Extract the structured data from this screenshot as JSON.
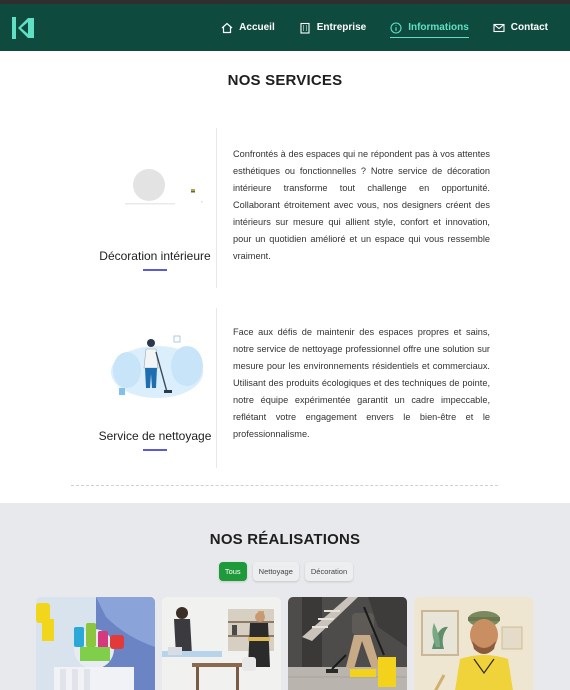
{
  "colors": {
    "navbar": "#0f4a3e",
    "active": "#5fe0c4",
    "accent_underline": "#5b5bd6",
    "filter_active": "#1e9a3a"
  },
  "nav": {
    "items": [
      {
        "label": "Accueil",
        "icon": "home-icon"
      },
      {
        "label": "Entreprise",
        "icon": "building-icon"
      },
      {
        "label": "Informations",
        "icon": "info-icon",
        "active": true
      },
      {
        "label": "Contact",
        "icon": "mail-icon"
      }
    ]
  },
  "services": {
    "title": "NOS SERVICES",
    "items": [
      {
        "label": "Décoration intérieure",
        "text": "Confrontés à des espaces qui ne répondent pas à vos attentes esthétiques ou fonctionnelles ? Notre service de décoration intérieure transforme tout challenge en opportunité. Collaborant étroitement avec vous, nos designers créent des intérieurs sur mesure qui allient style, confort et innovation, pour un quotidien amélioré et un espace qui vous ressemble vraiment."
      },
      {
        "label": "Service de nettoyage",
        "text": "Face aux défis de maintenir des espaces propres et sains, notre service de nettoyage professionnel offre une solution sur mesure pour les environnements résidentiels et commerciaux. Utilisant des produits écologiques et des techniques de pointe, notre équipe expérimentée garantit un cadre impeccable, reflétant votre engagement envers le bien-être et le professionnalisme."
      }
    ]
  },
  "realisations": {
    "title": "NOS RÉALISATIONS",
    "filters": [
      {
        "label": "Tous",
        "active": true
      },
      {
        "label": "Nettoyage"
      },
      {
        "label": "Décoration"
      }
    ]
  }
}
